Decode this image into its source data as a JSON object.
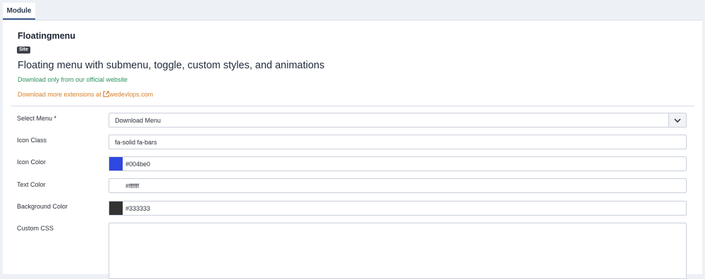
{
  "tabs": [
    {
      "label": "Module"
    }
  ],
  "module": {
    "title": "Floatingmenu",
    "badge": "Site",
    "description": "Floating menu with submenu, toggle, custom styles, and animations",
    "official_note": "Download only from our official website",
    "more_prefix": "Download more extensions at ",
    "more_link": "wedevlops.com"
  },
  "form": {
    "select_menu": {
      "label": "Select Menu *",
      "value": "Download Menu"
    },
    "icon_class": {
      "label": "Icon Class",
      "value": "fa-solid fa-bars"
    },
    "icon_color": {
      "label": "Icon Color",
      "value": "#004be0",
      "swatch": "#2e48e0"
    },
    "text_color": {
      "label": "Text Color",
      "value": "#ffffff",
      "swatch": "#ffffff"
    },
    "background_color": {
      "label": "Background Color",
      "value": "#333333",
      "swatch": "#333333"
    },
    "custom_css": {
      "label": "Custom CSS",
      "value": ""
    }
  },
  "colors": {
    "tab_accent": "#3a5a8c",
    "green_link": "#2c8f5f",
    "orange_link": "#d5812e"
  },
  "icons": {
    "select_caret": "chevron-down-icon",
    "external_link": "external-link-icon"
  }
}
